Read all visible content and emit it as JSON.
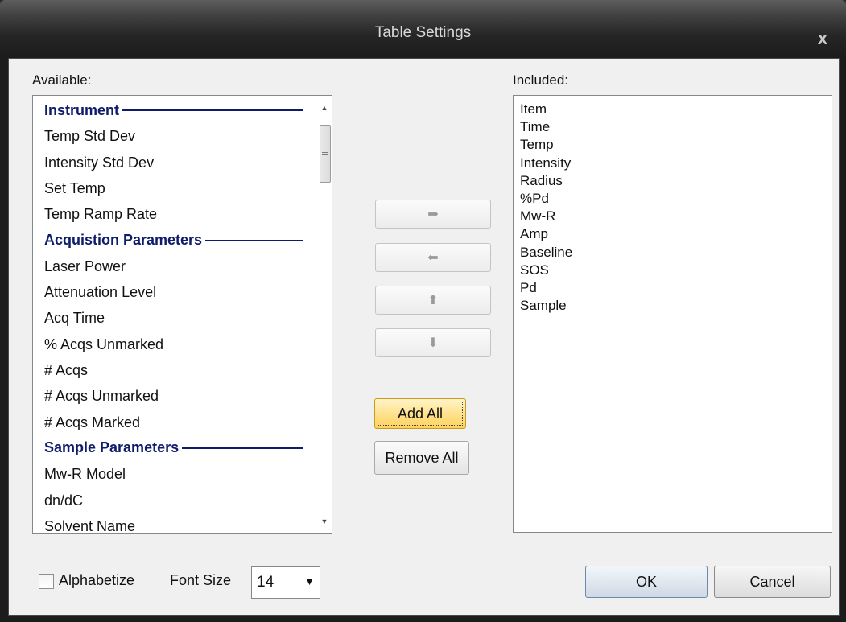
{
  "window": {
    "title": "Table Settings",
    "close_glyph": "x"
  },
  "available": {
    "label": "Available:",
    "groups": [
      {
        "header": "Instrument",
        "items": [
          "Temp Std Dev",
          "Intensity Std Dev",
          "Set Temp",
          "Temp Ramp Rate"
        ]
      },
      {
        "header": "Acquistion Parameters",
        "items": [
          "Laser Power",
          "Attenuation Level",
          "Acq Time",
          "% Acqs Unmarked",
          "# Acqs",
          "# Acqs Unmarked",
          "# Acqs Marked"
        ]
      },
      {
        "header": "Sample Parameters",
        "items": [
          "Mw-R  Model",
          "dn/dC",
          "Solvent Name"
        ]
      }
    ]
  },
  "included": {
    "label": "Included:",
    "items": [
      "Item",
      "Time",
      "Temp",
      "Intensity",
      "Radius",
      "%Pd",
      "Mw-R",
      "Amp",
      "Baseline",
      "SOS",
      "Pd",
      "Sample"
    ]
  },
  "move_buttons": [
    {
      "name": "move-right",
      "icon": "arrow-right-icon",
      "glyph": "➡"
    },
    {
      "name": "move-left",
      "icon": "arrow-left-icon",
      "glyph": "⬅"
    },
    {
      "name": "move-up",
      "icon": "arrow-up-icon",
      "glyph": "⬆"
    },
    {
      "name": "move-down",
      "icon": "arrow-down-icon",
      "glyph": "⬇"
    }
  ],
  "buttons": {
    "add_all": "Add All",
    "remove_all": "Remove All",
    "ok": "OK",
    "cancel": "Cancel"
  },
  "options": {
    "alphabetize_label": "Alphabetize",
    "alphabetize_checked": false,
    "font_size_label": "Font Size",
    "font_size_value": "14"
  },
  "colors": {
    "header_text": "#0d1c6b",
    "hot_button": "#ffd25b"
  }
}
